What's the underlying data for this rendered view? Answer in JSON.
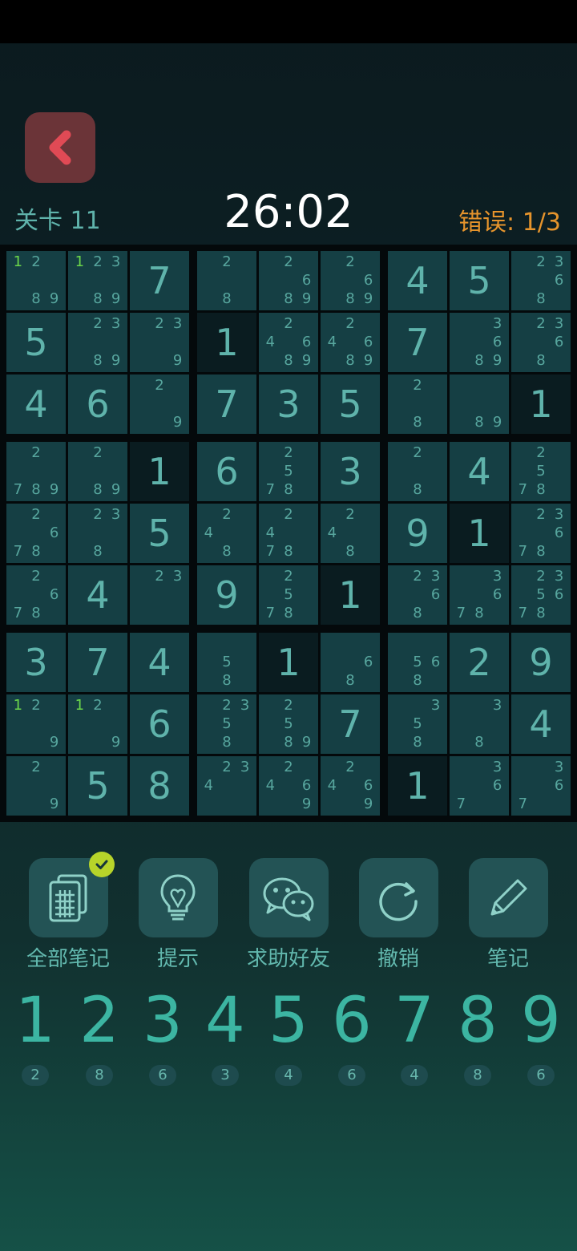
{
  "header": {
    "level_label": "关卡 11",
    "timer": "26:02",
    "errors_label": "错误: 1/3"
  },
  "colors": {
    "back_button": "#6b3438",
    "back_chevron": "#e04a55",
    "errors": "#e6942c",
    "digit": "#3cb5a2",
    "cell": "#153f44",
    "cell_dark": "#0a1c20",
    "note_highlight": "#6bd64a",
    "badge": "#b7d42a"
  },
  "board": {
    "values": [
      [
        "",
        "",
        "7",
        "",
        "",
        "",
        "4",
        "5",
        ""
      ],
      [
        "5",
        "",
        "",
        "1",
        "",
        "",
        "7",
        "",
        ""
      ],
      [
        "4",
        "6",
        "",
        "7",
        "3",
        "5",
        "",
        "",
        "1"
      ],
      [
        "",
        "",
        "1",
        "6",
        "",
        "3",
        "",
        "4",
        ""
      ],
      [
        "",
        "",
        "5",
        "",
        "",
        "",
        "9",
        "1",
        ""
      ],
      [
        "",
        "4",
        "",
        "9",
        "",
        "1",
        "",
        "",
        ""
      ],
      [
        "3",
        "7",
        "4",
        "",
        "1",
        "",
        "",
        "2",
        "9"
      ],
      [
        "",
        "",
        "6",
        "",
        "",
        "7",
        "",
        "",
        "4"
      ],
      [
        "",
        "5",
        "8",
        "",
        "",
        "",
        "1",
        "",
        ""
      ]
    ],
    "notes": [
      [
        [
          "1",
          "2",
          "8",
          "9"
        ],
        [
          "1",
          "2",
          "3",
          "8",
          "9"
        ],
        [],
        [
          "2",
          "8"
        ],
        [
          "2",
          "6",
          "8",
          "9"
        ],
        [
          "2",
          "6",
          "8",
          "9"
        ],
        [],
        [],
        [
          "2",
          "3",
          "6",
          "8"
        ]
      ],
      [
        [],
        [
          "2",
          "3",
          "8",
          "9"
        ],
        [
          "2",
          "3",
          "9"
        ],
        [],
        [
          "2",
          "4",
          "6",
          "8",
          "9"
        ],
        [
          "2",
          "4",
          "6",
          "8",
          "9"
        ],
        [],
        [
          "3",
          "6",
          "8",
          "9"
        ],
        [
          "2",
          "3",
          "6",
          "8"
        ]
      ],
      [
        [],
        [],
        [
          "2",
          "9"
        ],
        [],
        [],
        [],
        [
          "2",
          "8"
        ],
        [
          "8",
          "9"
        ],
        []
      ],
      [
        [
          "2",
          "7",
          "8",
          "9"
        ],
        [
          "2",
          "8",
          "9"
        ],
        [],
        [],
        [
          "2",
          "5",
          "7",
          "8"
        ],
        [],
        [
          "2",
          "8"
        ],
        [],
        [
          "2",
          "5",
          "7",
          "8"
        ]
      ],
      [
        [
          "2",
          "6",
          "7",
          "8"
        ],
        [
          "2",
          "3",
          "8"
        ],
        [],
        [
          "2",
          "4",
          "8"
        ],
        [
          "2",
          "4",
          "7",
          "8"
        ],
        [
          "2",
          "4",
          "8"
        ],
        [],
        [],
        [
          "2",
          "3",
          "6",
          "7",
          "8"
        ]
      ],
      [
        [
          "2",
          "6",
          "7",
          "8"
        ],
        [],
        [
          "2",
          "3"
        ],
        [],
        [
          "2",
          "5",
          "7",
          "8"
        ],
        [],
        [
          "2",
          "3",
          "6",
          "8"
        ],
        [
          "3",
          "6",
          "7",
          "8"
        ],
        [
          "2",
          "3",
          "5",
          "6",
          "7",
          "8"
        ]
      ],
      [
        [],
        [],
        [],
        [
          "5",
          "8"
        ],
        [],
        [
          "6",
          "8"
        ],
        [
          "5",
          "6",
          "8"
        ],
        [],
        []
      ],
      [
        [
          "1",
          "2",
          "9"
        ],
        [
          "1",
          "2",
          "9"
        ],
        [],
        [
          "2",
          "3",
          "5",
          "8"
        ],
        [
          "2",
          "5",
          "8",
          "9"
        ],
        [],
        [
          "3",
          "5",
          "8"
        ],
        [
          "3",
          "8"
        ],
        []
      ],
      [
        [
          "2",
          "9"
        ],
        [],
        [],
        [
          "2",
          "3",
          "4"
        ],
        [
          "2",
          "4",
          "6",
          "9"
        ],
        [
          "2",
          "4",
          "6",
          "9"
        ],
        [],
        [
          "3",
          "6",
          "7"
        ],
        [
          "3",
          "6",
          "7"
        ]
      ]
    ],
    "highlighted_notes": [
      [
        0,
        0,
        "1"
      ],
      [
        0,
        1,
        "1"
      ],
      [
        7,
        0,
        "1"
      ],
      [
        7,
        1,
        "1"
      ]
    ]
  },
  "tools": [
    {
      "label": "全部笔记",
      "icon": "all-notes-icon",
      "checked": true
    },
    {
      "label": "提示",
      "icon": "lightbulb-icon",
      "checked": false
    },
    {
      "label": "求助好友",
      "icon": "wechat-icon",
      "checked": false
    },
    {
      "label": "撤销",
      "icon": "undo-icon",
      "checked": false
    },
    {
      "label": "笔记",
      "icon": "pencil-icon",
      "checked": false
    }
  ],
  "numpad": [
    {
      "digit": "1",
      "count": "2"
    },
    {
      "digit": "2",
      "count": "8"
    },
    {
      "digit": "3",
      "count": "6"
    },
    {
      "digit": "4",
      "count": "3"
    },
    {
      "digit": "5",
      "count": "4"
    },
    {
      "digit": "6",
      "count": "6"
    },
    {
      "digit": "7",
      "count": "4"
    },
    {
      "digit": "8",
      "count": "8"
    },
    {
      "digit": "9",
      "count": "6"
    }
  ]
}
